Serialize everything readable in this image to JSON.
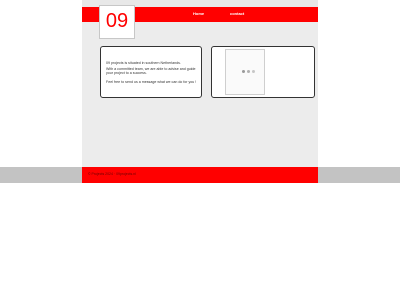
{
  "header": {
    "logo_text": "09",
    "nav": [
      {
        "label": "Home"
      },
      {
        "label": "contact"
      }
    ]
  },
  "content": {
    "paragraphs": [
      "09 projects is situated in southern Netherlands.",
      "With a committed team, we are able to advise and guide your project to a success.",
      "Feel free to send us a message what we can do for you !"
    ]
  },
  "footer": {
    "text": "© Projects 2024 · 09projects.nl"
  },
  "colors": {
    "brand_red": "#ff0000",
    "page_gray": "#ececec",
    "footer_gray": "#c3c3c3"
  },
  "icons": {
    "media_loader": "loading-dots-icon"
  }
}
